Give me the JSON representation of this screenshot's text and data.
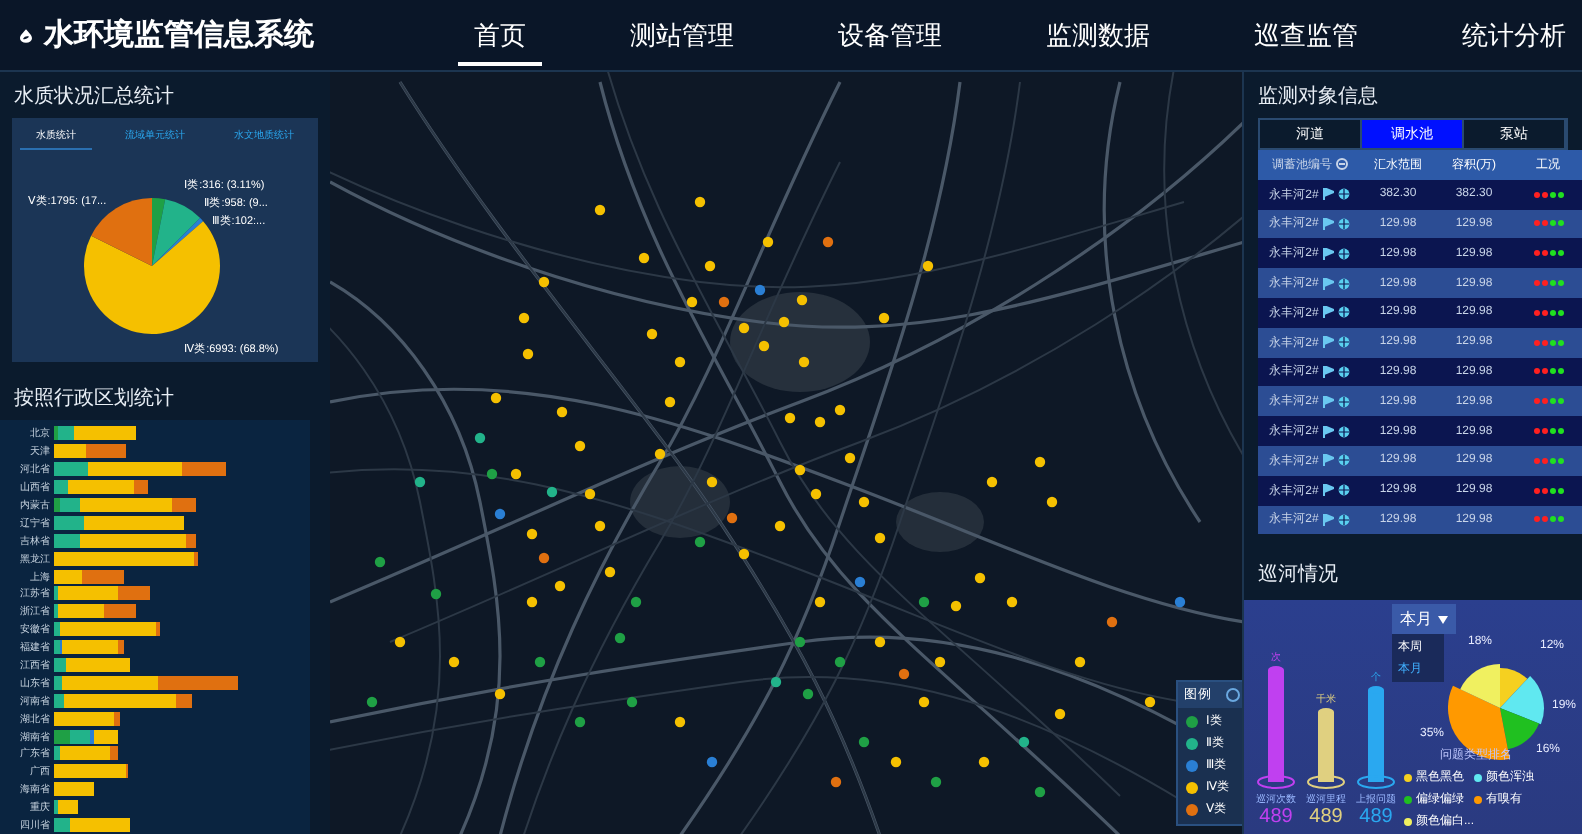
{
  "header": {
    "title": "水环境监管信息系统",
    "nav": [
      {
        "label": "首页",
        "selected": true
      },
      {
        "label": "测站管理",
        "selected": false
      },
      {
        "label": "设备管理",
        "selected": false
      },
      {
        "label": "监测数据",
        "selected": false
      },
      {
        "label": "巡查监管",
        "selected": false
      },
      {
        "label": "统计分析",
        "selected": false
      }
    ]
  },
  "quality_panel": {
    "title": "水质状况汇总统计",
    "tabs": [
      {
        "label": "水质统计",
        "selected": true
      },
      {
        "label": "流域单元统计",
        "selected": false
      },
      {
        "label": "水文地质统计",
        "selected": false
      }
    ],
    "pie_labels": [
      "Ⅰ类:316: (3.11%)",
      "Ⅱ类:958: (9...",
      "Ⅲ类:102:...",
      "Ⅳ类:6993: (68.8%)",
      "Ⅴ类:1795: (17..."
    ]
  },
  "region_panel": {
    "title": "按照行政区划统计",
    "provinces": [
      "北京",
      "天津",
      "河北省",
      "山西省",
      "内蒙古",
      "辽宁省",
      "吉林省",
      "黑龙江",
      "上海",
      "江苏省",
      "浙江省",
      "安徽省",
      "福建省",
      "江西省",
      "山东省",
      "河南省",
      "湖北省",
      "湖南省",
      "广东省",
      "广西",
      "海南省",
      "重庆",
      "四川省"
    ]
  },
  "legend": {
    "title": "图例",
    "items": [
      {
        "label": "Ⅰ类",
        "color": "#1fa045"
      },
      {
        "label": "Ⅱ类",
        "color": "#22b38a"
      },
      {
        "label": "Ⅲ类",
        "color": "#2a7fd4"
      },
      {
        "label": "Ⅳ类",
        "color": "#f5c000"
      },
      {
        "label": "Ⅴ类",
        "color": "#e07010"
      }
    ]
  },
  "monitor_panel": {
    "title": "监测对象信息",
    "tabs": [
      {
        "label": "河道",
        "selected": false
      },
      {
        "label": "调水池",
        "selected": true
      },
      {
        "label": "泵站",
        "selected": false
      }
    ],
    "columns": [
      "调蓄池编号",
      "汇水范围",
      "容积(万)",
      "工况"
    ],
    "rows": [
      {
        "name": "永丰河2#",
        "area": "382.30",
        "volume": "382.30",
        "status": [
          {
            "color": "#ff2020"
          },
          {
            "color": "#ff2020"
          },
          {
            "color": "#20e020"
          },
          {
            "color": "#20e020"
          }
        ]
      },
      {
        "name": "永丰河2#",
        "area": "129.98",
        "volume": "129.98",
        "status": [
          {
            "color": "#ff2020"
          },
          {
            "color": "#ff2020"
          },
          {
            "color": "#20e020"
          },
          {
            "color": "#20e020"
          }
        ]
      },
      {
        "name": "永丰河2#",
        "area": "129.98",
        "volume": "129.98",
        "status": [
          {
            "color": "#ff2020"
          },
          {
            "color": "#ff2020"
          },
          {
            "color": "#20e020"
          },
          {
            "color": "#20e020"
          }
        ]
      },
      {
        "name": "永丰河2#",
        "area": "129.98",
        "volume": "129.98",
        "status": [
          {
            "color": "#ff2020"
          },
          {
            "color": "#ff2020"
          },
          {
            "color": "#20e020"
          },
          {
            "color": "#20e020"
          }
        ]
      },
      {
        "name": "永丰河2#",
        "area": "129.98",
        "volume": "129.98",
        "status": [
          {
            "color": "#ff2020"
          },
          {
            "color": "#ff2020"
          },
          {
            "color": "#20e020"
          },
          {
            "color": "#20e020"
          }
        ]
      },
      {
        "name": "永丰河2#",
        "area": "129.98",
        "volume": "129.98",
        "status": [
          {
            "color": "#ff2020"
          },
          {
            "color": "#ff2020"
          },
          {
            "color": "#20e020"
          },
          {
            "color": "#20e020"
          }
        ]
      },
      {
        "name": "永丰河2#",
        "area": "129.98",
        "volume": "129.98",
        "status": [
          {
            "color": "#ff2020"
          },
          {
            "color": "#ff2020"
          },
          {
            "color": "#20e020"
          },
          {
            "color": "#20e020"
          }
        ]
      },
      {
        "name": "永丰河2#",
        "area": "129.98",
        "volume": "129.98",
        "status": [
          {
            "color": "#ff2020"
          },
          {
            "color": "#ff2020"
          },
          {
            "color": "#20e020"
          },
          {
            "color": "#20e020"
          }
        ]
      },
      {
        "name": "永丰河2#",
        "area": "129.98",
        "volume": "129.98",
        "status": [
          {
            "color": "#ff2020"
          },
          {
            "color": "#ff2020"
          },
          {
            "color": "#20e020"
          },
          {
            "color": "#20e020"
          }
        ]
      },
      {
        "name": "永丰河2#",
        "area": "129.98",
        "volume": "129.98",
        "status": [
          {
            "color": "#ff2020"
          },
          {
            "color": "#ff2020"
          },
          {
            "color": "#20e020"
          },
          {
            "color": "#20e020"
          }
        ]
      },
      {
        "name": "永丰河2#",
        "area": "129.98",
        "volume": "129.98",
        "status": [
          {
            "color": "#ff2020"
          },
          {
            "color": "#ff2020"
          },
          {
            "color": "#20e020"
          },
          {
            "color": "#20e020"
          }
        ]
      },
      {
        "name": "永丰河2#",
        "area": "129.98",
        "volume": "129.98",
        "status": [
          {
            "color": "#ff2020"
          },
          {
            "color": "#ff2020"
          },
          {
            "color": "#20e020"
          },
          {
            "color": "#20e020"
          }
        ]
      }
    ]
  },
  "patrol_panel": {
    "title": "巡河情况",
    "period": "本月",
    "period_options": [
      {
        "label": "本周",
        "selected": false
      },
      {
        "label": "本月",
        "selected": true
      }
    ],
    "stats": [
      {
        "unit": "次",
        "label": "巡河次数",
        "value": "489",
        "color": "#c040f0"
      },
      {
        "unit": "千米",
        "label": "巡河里程",
        "value": "489",
        "color": "#e0d080"
      },
      {
        "unit": "个",
        "label": "上报问题",
        "value": "489",
        "color": "#2aa8f0"
      }
    ],
    "pie_title": "问题类型排名",
    "pie_value_labels": [
      "12%",
      "19%",
      "16%",
      "35%",
      "18%"
    ],
    "pie_legend": [
      {
        "label": "黑色黑色",
        "color": "#f5d020"
      },
      {
        "label": "颜色浑浊",
        "color": "#60e8f0"
      },
      {
        "label": "偏绿偏绿",
        "color": "#20c020"
      },
      {
        "label": "有嗅有",
        "color": "#ff9900"
      },
      {
        "label": "颜色偏白...",
        "color": "#f0f060"
      }
    ]
  }
}
